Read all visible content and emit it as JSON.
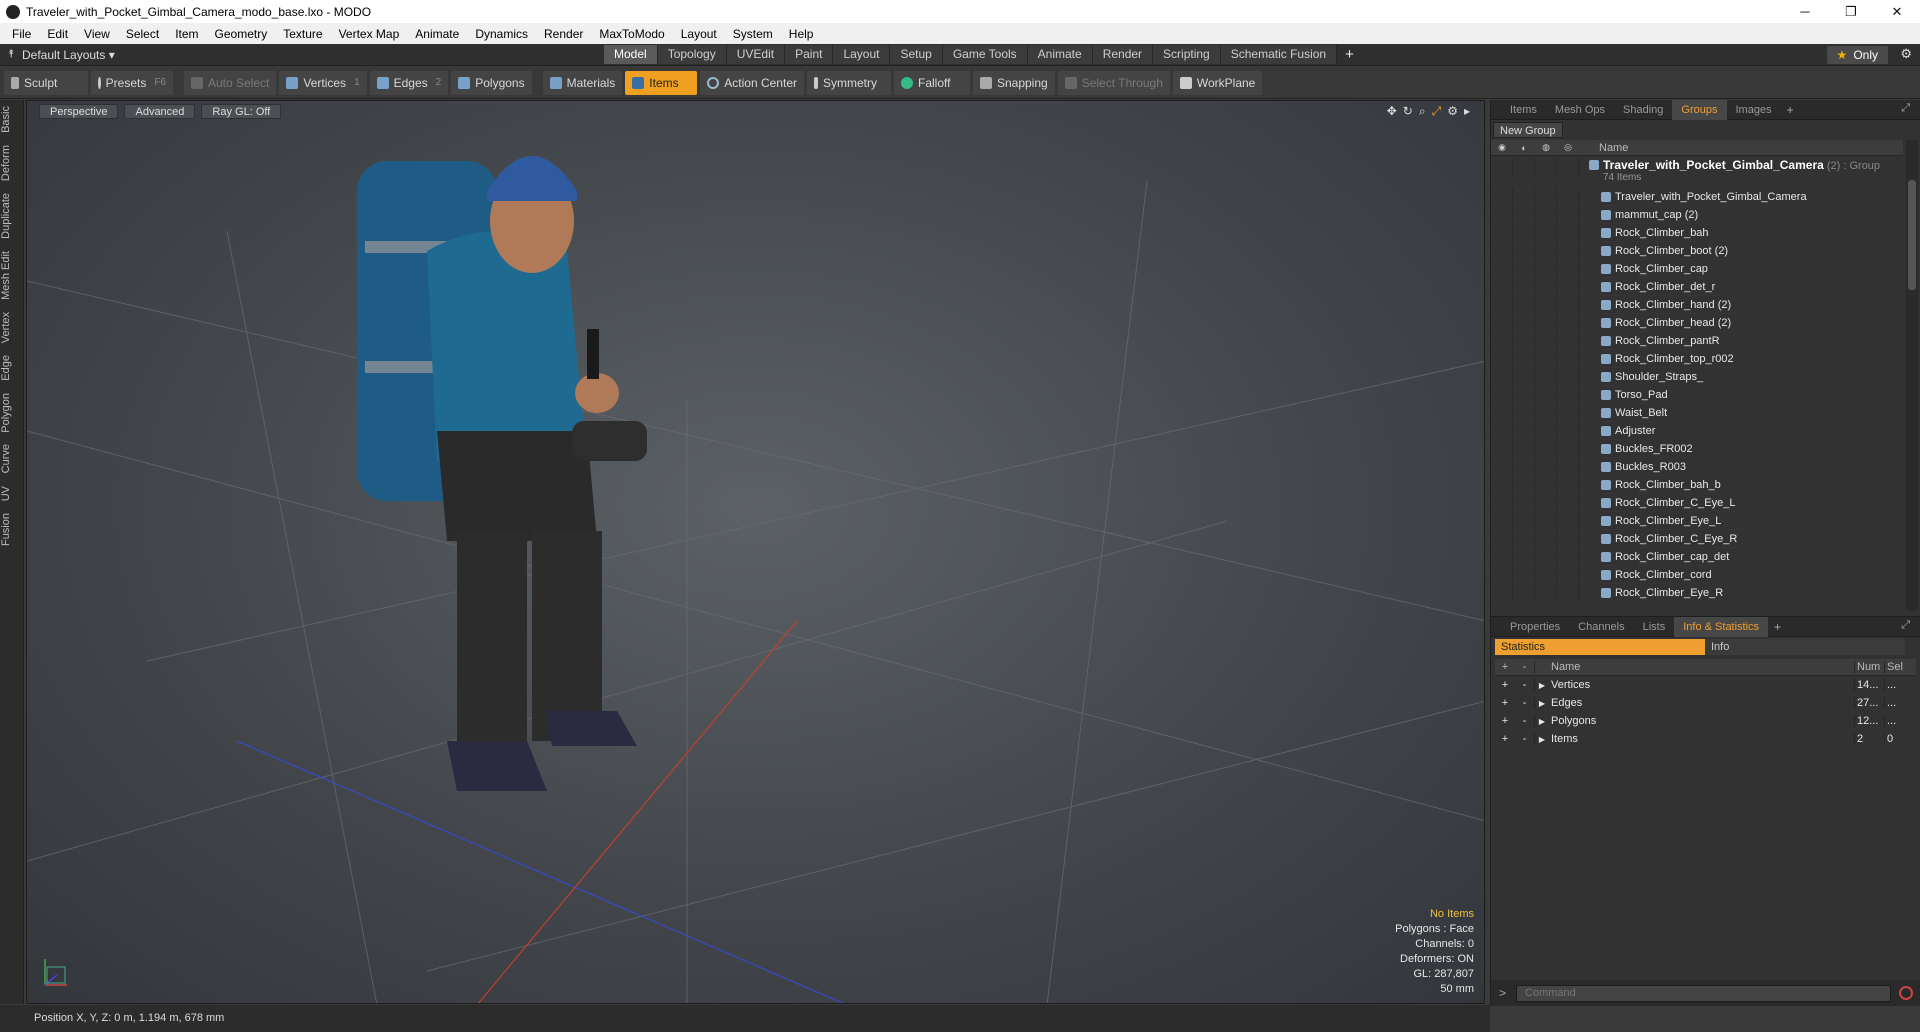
{
  "window": {
    "title": "Traveler_with_Pocket_Gimbal_Camera_modo_base.lxo - MODO"
  },
  "menu": [
    "File",
    "Edit",
    "View",
    "Select",
    "Item",
    "Geometry",
    "Texture",
    "Vertex Map",
    "Animate",
    "Dynamics",
    "Render",
    "MaxToModo",
    "Layout",
    "System",
    "Help"
  ],
  "layoutbar": {
    "layouts_label": "Default Layouts ▾",
    "tabs": [
      "Model",
      "Topology",
      "UVEdit",
      "Paint",
      "Layout",
      "Setup",
      "Game Tools",
      "Animate",
      "Render",
      "Scripting",
      "Schematic Fusion"
    ],
    "active_tab": "Model",
    "only_label": "Only"
  },
  "toolbar": {
    "sculpt": "Sculpt",
    "presets": "Presets",
    "presets_key": "F6",
    "auto_select": "Auto Select",
    "vertices": "Vertices",
    "vertices_num": "1",
    "edges": "Edges",
    "edges_num": "2",
    "polygons": "Polygons",
    "materials": "Materials",
    "items": "Items",
    "action_center": "Action Center",
    "symmetry": "Symmetry",
    "falloff": "Falloff",
    "snapping": "Snapping",
    "select_through": "Select Through",
    "workplane": "WorkPlane"
  },
  "left_tabs": [
    "Basic",
    "Deform",
    "Duplicate",
    "Mesh Edit",
    "Vertex",
    "Edge",
    "Polygon",
    "Curve",
    "UV",
    "Fusion"
  ],
  "viewport": {
    "view": "Perspective",
    "shading": "Advanced",
    "raygl": "Ray GL: Off",
    "stats": {
      "no_items": "No Items",
      "polygons": "Polygons : Face",
      "channels": "Channels: 0",
      "deformers": "Deformers: ON",
      "gl": "GL: 287,807",
      "focal": "50 mm"
    }
  },
  "status": {
    "position": "Position X, Y, Z:  0 m, 1.194 m, 678 mm"
  },
  "items_panel": {
    "tabs": [
      "Items",
      "Mesh Ops",
      "Shading",
      "Groups",
      "Images"
    ],
    "active_tab": "Groups",
    "new_group": "New Group",
    "col_name": "Name",
    "group": {
      "name": "Traveler_with_Pocket_Gimbal_Camera",
      "count": "(2)",
      "type": ": Group",
      "sub": "74 Items"
    },
    "items": [
      "Traveler_with_Pocket_Gimbal_Camera",
      "mammut_cap (2)",
      "Rock_Climber_bah",
      "Rock_Climber_boot (2)",
      "Rock_Climber_cap",
      "Rock_Climber_det_r",
      "Rock_Climber_hand (2)",
      "Rock_Climber_head (2)",
      "Rock_Climber_pantR",
      "Rock_Climber_top_r002",
      "Shoulder_Straps_",
      "Torso_Pad",
      "Waist_Belt",
      "Adjuster",
      "Buckles_FR002",
      "Buckles_R003",
      "Rock_Climber_bah_b",
      "Rock_Climber_C_Eye_L",
      "Rock_Climber_Eye_L",
      "Rock_Climber_C_Eye_R",
      "Rock_Climber_cap_det",
      "Rock_Climber_cord",
      "Rock_Climber_Eye_R"
    ]
  },
  "info_panel": {
    "tabs": [
      "Properties",
      "Channels",
      "Lists",
      "Info & Statistics"
    ],
    "active_tab": "Info & Statistics",
    "sub_tabs": {
      "statistics": "Statistics",
      "info": "Info"
    },
    "cols": {
      "name": "Name",
      "num": "Num",
      "sel": "Sel"
    },
    "rows": [
      {
        "name": "Vertices",
        "num": "14...",
        "sel": "..."
      },
      {
        "name": "Edges",
        "num": "27...",
        "sel": "..."
      },
      {
        "name": "Polygons",
        "num": "12...",
        "sel": "..."
      },
      {
        "name": "Items",
        "num": "2",
        "sel": "0"
      }
    ],
    "command_placeholder": "Command"
  },
  "colors": {
    "accent": "#f0a030",
    "viewport_bg": "#4a4e52"
  }
}
